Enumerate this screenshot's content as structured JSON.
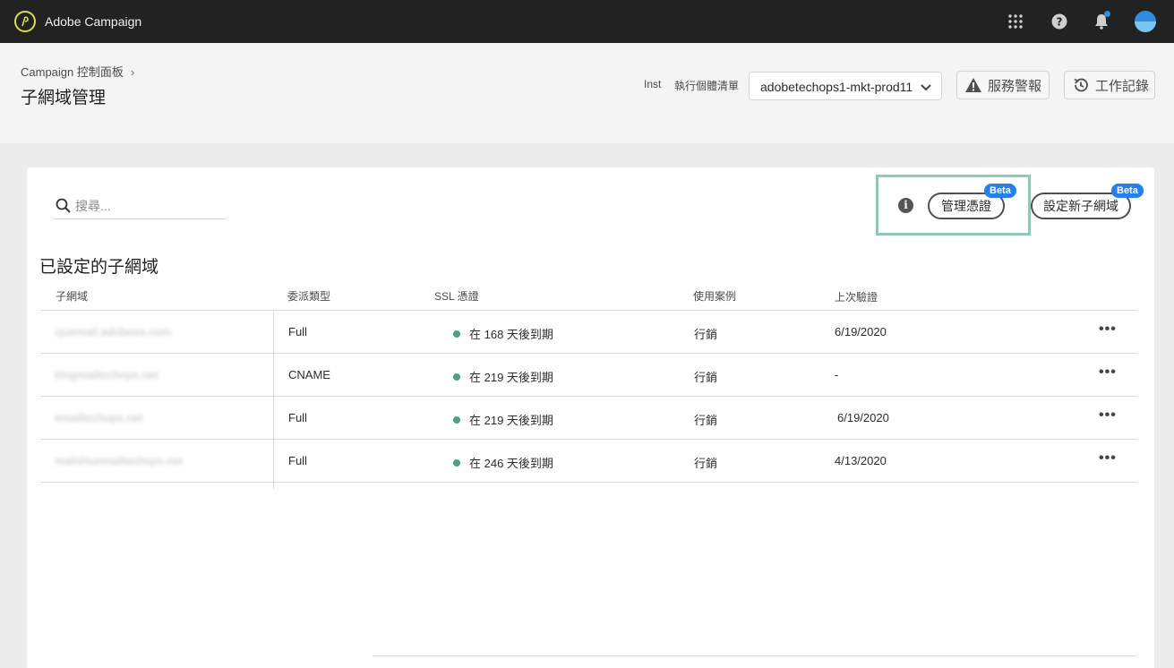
{
  "app": {
    "title": "Adobe Campaign"
  },
  "icons": {
    "logo": "adobe-campaign-logo",
    "apps": "apps-grid-icon",
    "help": "help-icon",
    "notifications": "bell-icon",
    "avatar": "user-avatar"
  },
  "header": {
    "breadcrumb": "Campaign 控制面板",
    "title": "子網域管理",
    "instance_label_clipped": "Insta",
    "instance_label": "執行個體清單",
    "instance_value": "adobetechops1-mkt-prod11",
    "alert_button": "服務警報",
    "log_button": "工作記錄"
  },
  "toolbar": {
    "search_placeholder": "搜尋...",
    "manage_button": "管理憑證",
    "new_button": "設定新子網域",
    "beta_badge": "Beta"
  },
  "section": {
    "title": "已設定的子網域"
  },
  "table": {
    "headers": {
      "subdomain": "子網域",
      "delegation": "委派類型",
      "ssl": "SSL 憑證",
      "use_case": "使用案例",
      "last_verified": "上次驗證"
    },
    "rows": [
      {
        "subdomain": "cjuemail.adobeea.com",
        "delegation": "Full",
        "ssl": "在 168 天後到期",
        "use_case": "行銷",
        "last_verified": "6/19/2020",
        "more": "•••"
      },
      {
        "subdomain": "blogmailtechops.net",
        "delegation": "CNAME",
        "ssl": "在 219 天後到期",
        "use_case": "行銷",
        "last_verified": "-",
        "more": "•••"
      },
      {
        "subdomain": "emailtechops.net",
        "delegation": "Full",
        "ssl": "在 219 天後到期",
        "use_case": "行銷",
        "last_verified": "6/19/2020",
        "more": "•••"
      },
      {
        "subdomain": "mailshuemailtechops.net",
        "delegation": "Full",
        "ssl": "在 246 天後到期",
        "use_case": "行銷",
        "last_verified": "4/13/2020",
        "more": "•••"
      }
    ]
  },
  "colors": {
    "topbar": "#222222",
    "accent": "#2680eb",
    "status_ok": "#4ba37c",
    "highlight": "#8fc9b4"
  }
}
